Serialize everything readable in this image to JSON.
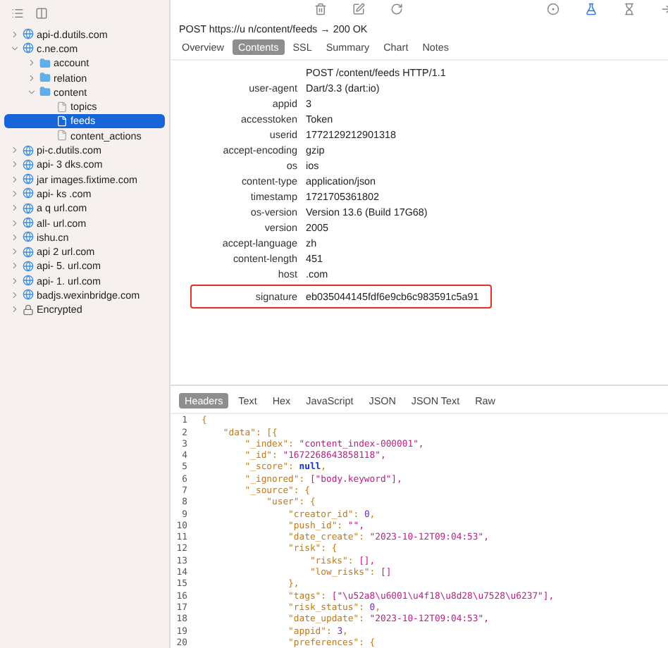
{
  "sidebar": {
    "items": [
      {
        "label": "api-d.dutils.com",
        "kind": "host",
        "expanded": false,
        "selected": false
      },
      {
        "label": "c.ne.com",
        "kind": "host",
        "expanded": true,
        "selected": false,
        "children": [
          {
            "label": "account",
            "kind": "folder",
            "expanded": false,
            "selected": false
          },
          {
            "label": "relation",
            "kind": "folder",
            "expanded": false,
            "selected": false
          },
          {
            "label": "content",
            "kind": "folder",
            "expanded": true,
            "selected": false,
            "children": [
              {
                "label": "topics",
                "kind": "file",
                "selected": false
              },
              {
                "label": "feeds",
                "kind": "file",
                "selected": true
              },
              {
                "label": "content_actions",
                "kind": "file",
                "selected": false
              }
            ]
          }
        ]
      },
      {
        "label": "pi-c.dutils.com",
        "kind": "host",
        "expanded": false,
        "selected": false
      },
      {
        "label": "api- 3 dks.com",
        "kind": "host",
        "expanded": false,
        "selected": false
      },
      {
        "label": "jar images.fixtime.com",
        "kind": "host",
        "expanded": false,
        "selected": false
      },
      {
        "label": "api- ks .com",
        "kind": "host",
        "expanded": false,
        "selected": false
      },
      {
        "label": "a q url.com",
        "kind": "host",
        "expanded": false,
        "selected": false
      },
      {
        "label": "all- url.com",
        "kind": "host",
        "expanded": false,
        "selected": false
      },
      {
        "label": "ishu.cn",
        "kind": "host",
        "expanded": false,
        "selected": false
      },
      {
        "label": "api 2 url.com",
        "kind": "host",
        "expanded": false,
        "selected": false
      },
      {
        "label": "api- 5. url.com",
        "kind": "host",
        "expanded": false,
        "selected": false
      },
      {
        "label": "api- 1. url.com",
        "kind": "host",
        "expanded": false,
        "selected": false
      },
      {
        "label": "badjs.wexinbridge.com",
        "kind": "host",
        "expanded": false,
        "selected": false
      },
      {
        "label": "Encrypted",
        "kind": "lock",
        "expanded": false,
        "selected": false
      }
    ]
  },
  "request": {
    "title": "POST https://u n/content/feeds → 200 OK",
    "tabs": [
      {
        "label": "Overview",
        "selected": false
      },
      {
        "label": "Contents",
        "selected": true
      },
      {
        "label": "SSL",
        "selected": false
      },
      {
        "label": "Summary",
        "selected": false
      },
      {
        "label": "Chart",
        "selected": false
      },
      {
        "label": "Notes",
        "selected": false
      }
    ],
    "headers": [
      {
        "value": "POST /content/feeds HTTP/1.1",
        "highlighted": false
      },
      {
        "name": "user-agent",
        "value": "Dart/3.3 (dart:io)",
        "highlighted": false
      },
      {
        "name": "appid",
        "value": "3",
        "highlighted": false
      },
      {
        "name": "accesstoken",
        "value": "Token",
        "highlighted": false
      },
      {
        "name": "userid",
        "value": "1772129212901318",
        "highlighted": false
      },
      {
        "name": "accept-encoding",
        "value": "gzip",
        "highlighted": false
      },
      {
        "name": "os",
        "value": "ios",
        "highlighted": false
      },
      {
        "name": "content-type",
        "value": "application/json",
        "highlighted": false
      },
      {
        "name": "timestamp",
        "value": "1721705361802",
        "highlighted": false
      },
      {
        "name": "os-version",
        "value": "Version 13.6 (Build 17G68)",
        "highlighted": false
      },
      {
        "name": "version",
        "value": "2005",
        "highlighted": false
      },
      {
        "name": "accept-language",
        "value": "zh",
        "highlighted": false
      },
      {
        "name": "content-length",
        "value": "451",
        "highlighted": false
      },
      {
        "name": "host",
        "value": ".com",
        "highlighted": false
      },
      {
        "name": "signature",
        "value": "eb035044145fdf6e9cb6c983591c5a91",
        "highlighted": true
      }
    ]
  },
  "response": {
    "tabs": [
      {
        "label": "Headers",
        "selected": true
      },
      {
        "label": "Text",
        "selected": false
      },
      {
        "label": "Hex",
        "selected": false
      },
      {
        "label": "JavaScript",
        "selected": false
      },
      {
        "label": "JSON",
        "selected": false
      },
      {
        "label": "JSON Text",
        "selected": false
      },
      {
        "label": "Raw",
        "selected": false
      }
    ],
    "lines": [
      {
        "number": "1",
        "tokens": [
          {
            "kind": "punct",
            "text": "{"
          }
        ]
      },
      {
        "number": "2",
        "tokens": [
          {
            "kind": "key",
            "text": "    \"data\": [{"
          }
        ]
      },
      {
        "number": "3",
        "tokens": [
          {
            "kind": "key",
            "text": "        \"_index\": "
          },
          {
            "kind": "string",
            "text": "\"content_index-000001\","
          }
        ]
      },
      {
        "number": "4",
        "tokens": [
          {
            "kind": "key",
            "text": "        \"_id\": "
          },
          {
            "kind": "string",
            "text": "\"1672268643858118\","
          }
        ]
      },
      {
        "number": "5",
        "tokens": [
          {
            "kind": "key",
            "text": "        \"_score\": "
          },
          {
            "kind": "null",
            "text": "null"
          },
          {
            "kind": "punct",
            "text": ","
          }
        ]
      },
      {
        "number": "6",
        "tokens": [
          {
            "kind": "key",
            "text": "        \"_ignored\": "
          },
          {
            "kind": "string",
            "text": "[\"body.keyword\"],"
          }
        ]
      },
      {
        "number": "7",
        "tokens": [
          {
            "kind": "key",
            "text": "        \"_source\": {"
          }
        ]
      },
      {
        "number": "8",
        "tokens": [
          {
            "kind": "key",
            "text": "            \"user\": {"
          }
        ]
      },
      {
        "number": "9",
        "tokens": [
          {
            "kind": "key",
            "text": "                \"creator_id\": "
          },
          {
            "kind": "number",
            "text": "0"
          },
          {
            "kind": "punct",
            "text": ","
          }
        ]
      },
      {
        "number": "10",
        "tokens": [
          {
            "kind": "key",
            "text": "                \"push_id\": "
          },
          {
            "kind": "string",
            "text": "\"\","
          }
        ]
      },
      {
        "number": "11",
        "tokens": [
          {
            "kind": "key",
            "text": "                \"date_create\": "
          },
          {
            "kind": "string",
            "text": "\"2023-10-12T09:04:53\","
          }
        ]
      },
      {
        "number": "12",
        "tokens": [
          {
            "kind": "key",
            "text": "                \"risk\": {"
          }
        ]
      },
      {
        "number": "13",
        "tokens": [
          {
            "kind": "key",
            "text": "                    \"risks\": "
          },
          {
            "kind": "string",
            "text": "[],"
          }
        ]
      },
      {
        "number": "14",
        "tokens": [
          {
            "kind": "key",
            "text": "                    \"low_risks\": "
          },
          {
            "kind": "string",
            "text": "[]"
          }
        ]
      },
      {
        "number": "15",
        "tokens": [
          {
            "kind": "key",
            "text": "                },"
          }
        ]
      },
      {
        "number": "16",
        "tokens": [
          {
            "kind": "key",
            "text": "                \"tags\": "
          },
          {
            "kind": "string",
            "text": "[\"\\u52a8\\u6001\\u4f18\\u8d28\\u7528\\u6237\"],"
          }
        ]
      },
      {
        "number": "17",
        "tokens": [
          {
            "kind": "key",
            "text": "                \"risk_status\": "
          },
          {
            "kind": "number",
            "text": "0"
          },
          {
            "kind": "punct",
            "text": ","
          }
        ]
      },
      {
        "number": "18",
        "tokens": [
          {
            "kind": "key",
            "text": "                \"date_update\": "
          },
          {
            "kind": "string",
            "text": "\"2023-10-12T09:04:53\","
          }
        ]
      },
      {
        "number": "19",
        "tokens": [
          {
            "kind": "key",
            "text": "                \"appid\": "
          },
          {
            "kind": "number",
            "text": "3"
          },
          {
            "kind": "punct",
            "text": ","
          }
        ]
      },
      {
        "number": "20",
        "tokens": [
          {
            "kind": "key",
            "text": "                \"preferences\": {"
          }
        ]
      }
    ]
  }
}
